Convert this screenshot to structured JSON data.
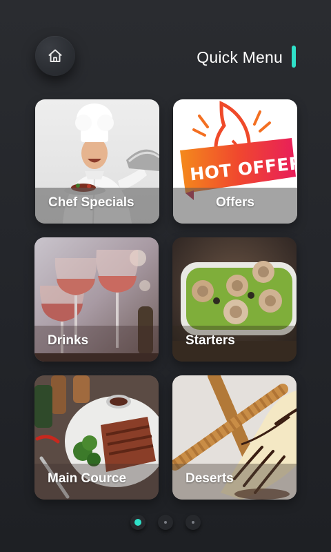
{
  "header": {
    "title": "Quick Menu",
    "home_icon": "home-icon"
  },
  "colors": {
    "accent": "#2fe0c8",
    "background": "#25272b"
  },
  "tiles": [
    {
      "label": "Chef Specials"
    },
    {
      "label": "Offers",
      "badge_text": "HOT OFFER"
    },
    {
      "label": "Drinks"
    },
    {
      "label": "Starters"
    },
    {
      "label": "Main Cource"
    },
    {
      "label": "Deserts"
    }
  ],
  "pager": {
    "pages": 3,
    "active": 1
  }
}
